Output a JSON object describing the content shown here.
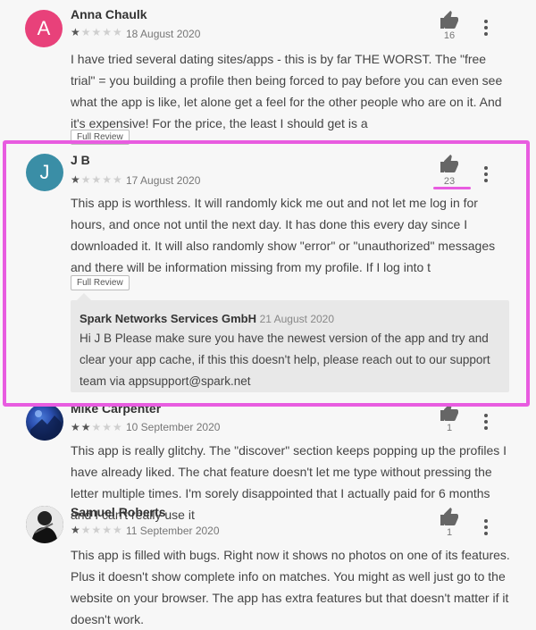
{
  "reviews": [
    {
      "author": "Anna Chaulk",
      "avatar_letter": "A",
      "avatar_color": "#e8417a",
      "stars": 1,
      "date": "18 August 2020",
      "helpful_count": "16",
      "text": "I have tried several dating sites/apps - this is by far THE WORST. The \"free trial\" = you building a profile then being forced to pay before you can even see what the app is like, let alone get a feel for the other people who are on it. And it's expensive! For the price, the least I should get is a",
      "full_review_label": "Full Review"
    },
    {
      "author": "J B",
      "avatar_letter": "J",
      "avatar_color": "#3a8ea6",
      "stars": 1,
      "date": "17 August 2020",
      "helpful_count": "23",
      "text": "This app is worthless. It will randomly kick me out and not let me log in for hours, and once not until the next day. It has done this every day since I downloaded it. It will also randomly show \"error\" or \"unauthorized\" messages and there will be information missing from my profile. If I log into t",
      "full_review_label": "Full Review",
      "developer_reply": {
        "name": "Spark Networks Services GmbH",
        "date": "21 August 2020",
        "text": "Hi J B Please make sure you have the newest version of the app and try and clear your app cache, if this this doesn't help, please reach out to our support team via appsupport@spark.net"
      }
    },
    {
      "author": "Mike Carpenter",
      "avatar_type": "photo",
      "stars": 2,
      "date": "10 September 2020",
      "helpful_count": "1",
      "text": "This app is really glitchy. The \"discover\" section keeps popping up the profiles I have already liked. The chat feature doesn't let me type without pressing the letter multiple times. I'm sorely disappointed that I actually paid for 6 months and I can't really use it"
    },
    {
      "author": "Samuel Roberts",
      "avatar_type": "photo",
      "stars": 1,
      "date": "11 September 2020",
      "helpful_count": "1",
      "text": "This app is filled with bugs. Right now it shows no photos on one of its features. Plus it doesn't show complete info on matches. You might as well just go to the website on your browser. The app has extra features but that doesn't matter if it doesn't work."
    }
  ],
  "star_on_glyph": "★",
  "star_off_glyph": "★★★★",
  "star_off_glyph_3": "★★★",
  "annotation_color": "#e85ce0"
}
